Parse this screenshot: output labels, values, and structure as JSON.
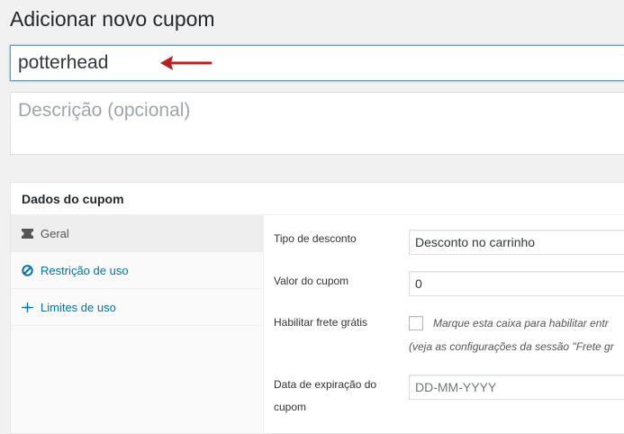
{
  "page": {
    "title": "Adicionar novo cupom"
  },
  "coupon_code": {
    "value": "potterhead"
  },
  "description": {
    "placeholder": "Descrição (opcional)"
  },
  "coupon_data": {
    "header": "Dados do cupom",
    "tabs": [
      {
        "label": "Geral",
        "icon": "ticket-icon"
      },
      {
        "label": "Restrição de uso",
        "icon": "block-icon"
      },
      {
        "label": "Limites de uso",
        "icon": "arrows-icon"
      }
    ],
    "fields": {
      "discount_type": {
        "label": "Tipo de desconto",
        "value": "Desconto no carrinho"
      },
      "coupon_amount": {
        "label": "Valor do cupom",
        "value": "0"
      },
      "free_shipping": {
        "label": "Habilitar frete grátis",
        "checkbox_text": "Marque esta caixa para habilitar entr",
        "note": "(veja as configurações da sessão \"Frete gr"
      },
      "expiry_date": {
        "label_line1": "Data de expiração do",
        "label_line2": "cupom",
        "placeholder": "DD-MM-YYYY"
      }
    }
  },
  "colors": {
    "accent": "#0073aa",
    "arrow": "#b52222",
    "focus_border": "#5b9dd9"
  }
}
